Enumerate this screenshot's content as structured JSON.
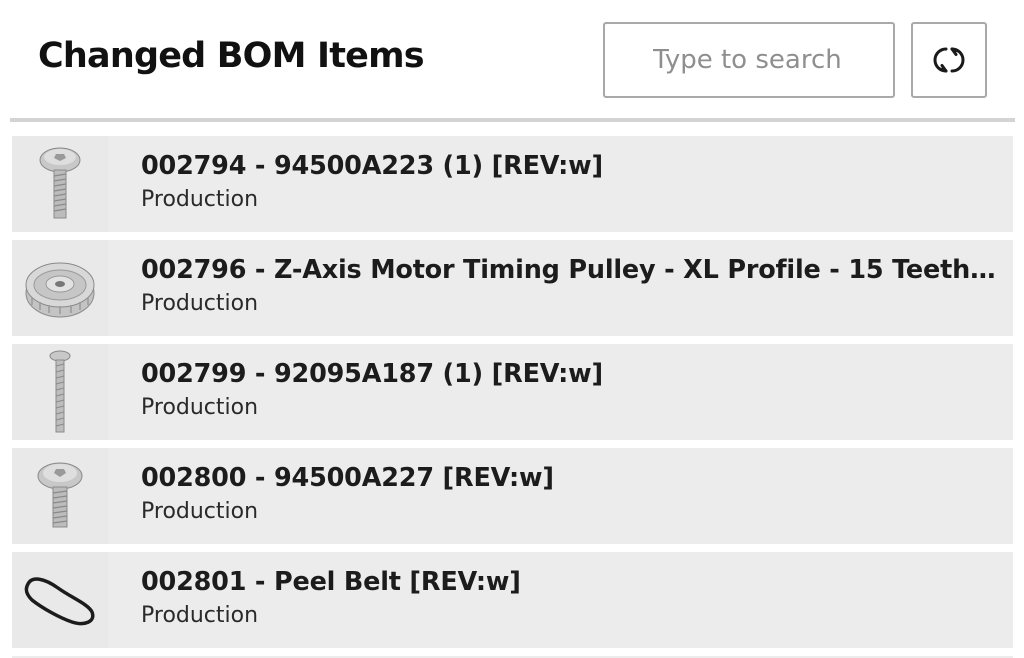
{
  "header": {
    "title": "Changed BOM Items",
    "search_placeholder": "Type to search",
    "refresh_icon": "refresh-icon"
  },
  "items": [
    {
      "title": "002794 - 94500A223 (1) [REV:w]",
      "status": "Production",
      "thumbnail": "button-head-screw-icon"
    },
    {
      "title": "002796 - Z-Axis Motor Timing Pulley - XL Profile - 15 Teeth …",
      "status": "Production",
      "thumbnail": "timing-pulley-icon"
    },
    {
      "title": "002799 - 92095A187 (1) [REV:w]",
      "status": "Production",
      "thumbnail": "long-screw-icon"
    },
    {
      "title": "002800 - 94500A227 [REV:w]",
      "status": "Production",
      "thumbnail": "button-head-screw-icon"
    },
    {
      "title": "002801 - Peel Belt [REV:w]",
      "status": "Production",
      "thumbnail": "belt-icon"
    }
  ]
}
